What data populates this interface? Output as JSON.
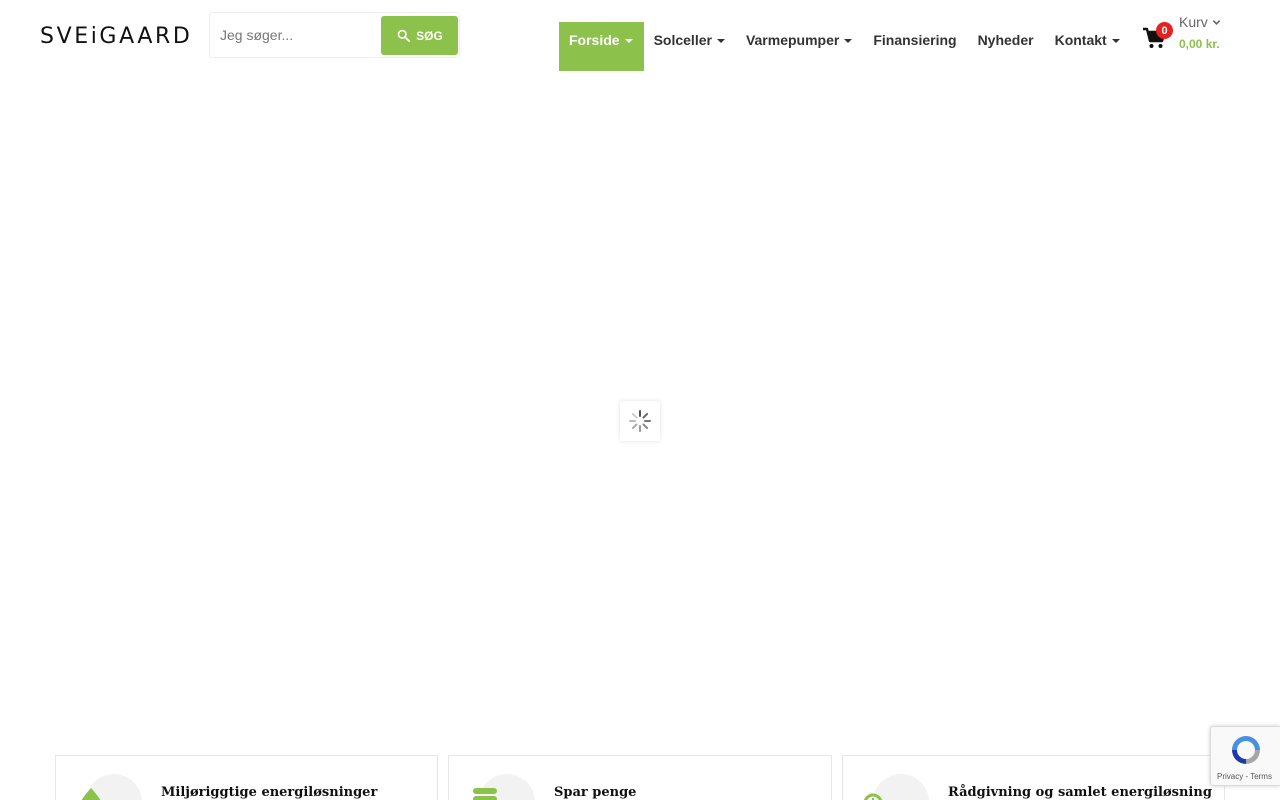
{
  "brand": {
    "logo_text": "SVEiGAARD"
  },
  "search": {
    "placeholder": "Jeg søger...",
    "value": "",
    "button_label": "SØG"
  },
  "nav": {
    "items": [
      {
        "label": "Forside",
        "active": true,
        "has_dropdown": true
      },
      {
        "label": "Solceller",
        "active": false,
        "has_dropdown": true
      },
      {
        "label": "Varmepumper",
        "active": false,
        "has_dropdown": true
      },
      {
        "label": "Finansiering",
        "active": false,
        "has_dropdown": false
      },
      {
        "label": "Nyheder",
        "active": false,
        "has_dropdown": false
      },
      {
        "label": "Kontakt",
        "active": false,
        "has_dropdown": true
      }
    ]
  },
  "cart": {
    "label": "Kurv",
    "count": "0",
    "total": "0,00 kr."
  },
  "features": [
    {
      "title": "Miljøriggtige energiløsninger",
      "icon": "leaf-icon"
    },
    {
      "title": "Spar penge",
      "icon": "coins-icon"
    },
    {
      "title": "Rådgivning og samlet energiløsning",
      "icon": "clock-icon"
    }
  ],
  "recaptcha": {
    "text": "Privacy - Terms"
  },
  "colors": {
    "accent": "#8cc14c",
    "badge": "#e8201f",
    "text": "#333333"
  }
}
